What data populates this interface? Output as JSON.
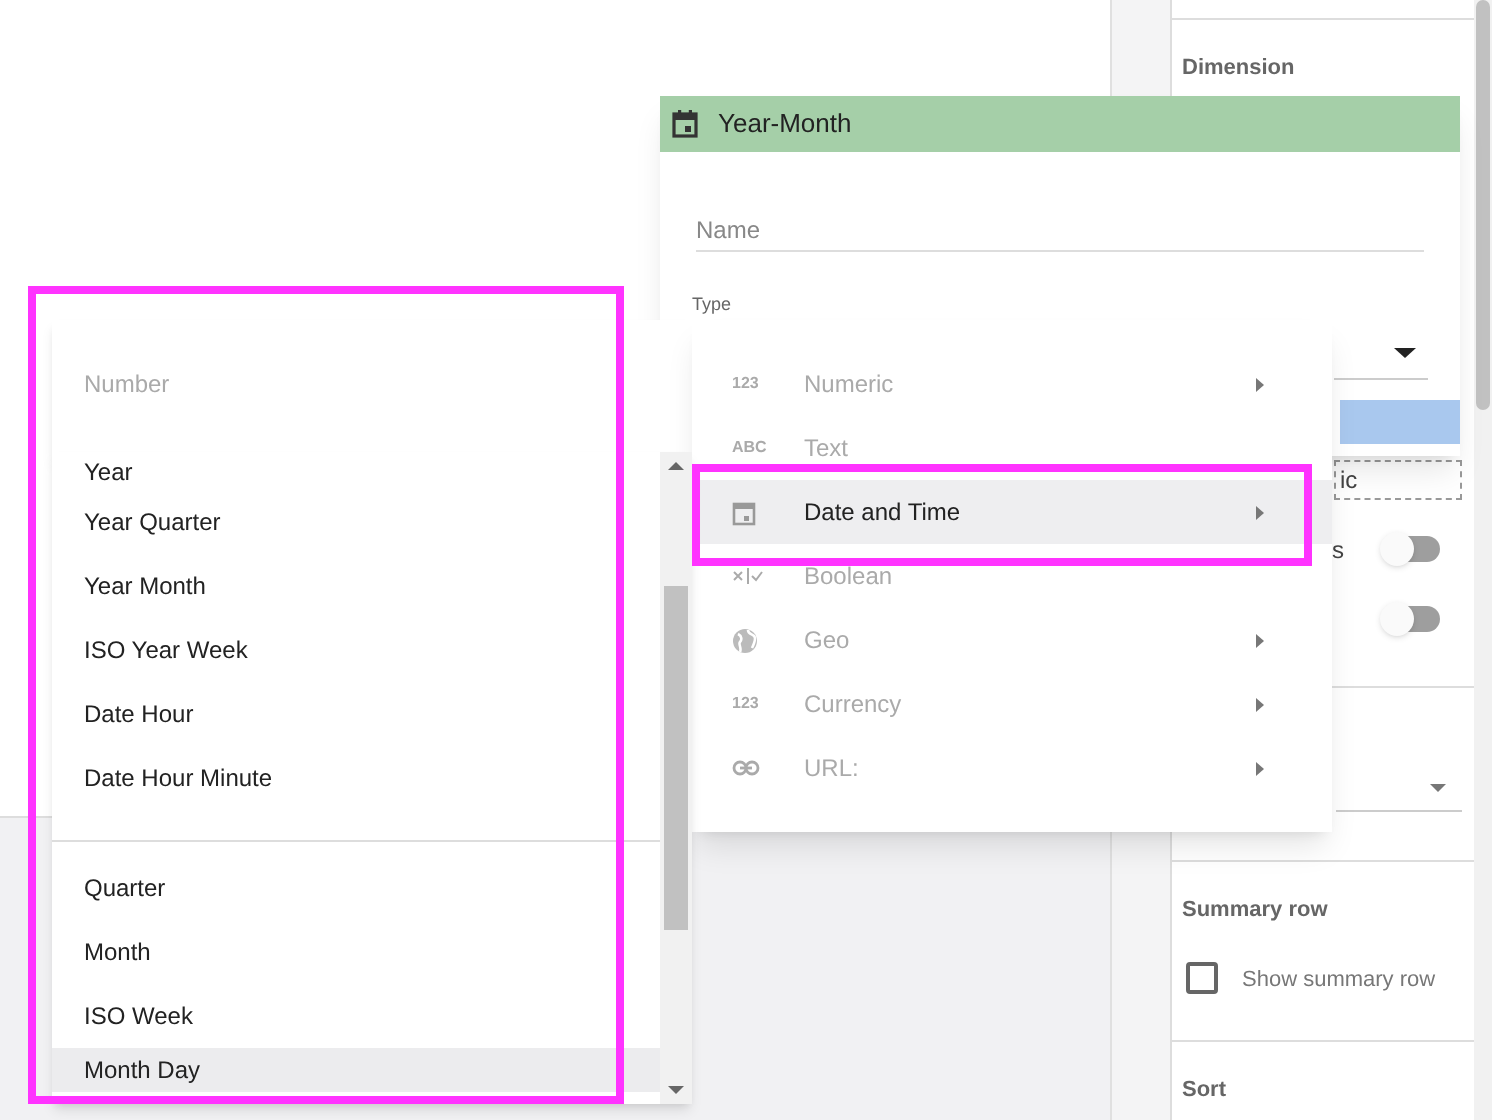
{
  "dialog": {
    "title": "Year-Month",
    "name_placeholder": "Name",
    "type_label": "Type"
  },
  "number_menu": {
    "items": [
      "Number"
    ]
  },
  "type_menu": {
    "items": [
      {
        "label": "Numeric",
        "glyph": "123",
        "disabled": true,
        "selected": false,
        "submenu": true
      },
      {
        "label": "Text",
        "glyph": "ABC",
        "disabled": true,
        "selected": false,
        "submenu": false
      },
      {
        "label": "Date and Time",
        "disabled": false,
        "selected": true,
        "submenu": true
      },
      {
        "label": "Boolean",
        "disabled": true,
        "selected": false,
        "submenu": false
      },
      {
        "label": "Geo",
        "disabled": true,
        "selected": false,
        "submenu": true
      },
      {
        "label": "Currency",
        "glyph": "123",
        "disabled": true,
        "selected": false,
        "submenu": true
      },
      {
        "label": "URL:",
        "disabled": true,
        "selected": false,
        "submenu": true
      }
    ]
  },
  "date_list": {
    "groups": [
      [
        {
          "label": "Year",
          "selected": false
        },
        {
          "label": "Year Quarter",
          "selected": false
        },
        {
          "label": "Year Month",
          "selected": false
        },
        {
          "label": "ISO Year Week",
          "selected": false
        },
        {
          "label": "Date Hour",
          "selected": false
        },
        {
          "label": "Date Hour Minute",
          "selected": false
        }
      ],
      [
        {
          "label": "Quarter",
          "selected": false
        },
        {
          "label": "Month",
          "selected": false
        },
        {
          "label": "ISO Week",
          "selected": false
        },
        {
          "label": "Month Day",
          "selected": true
        }
      ]
    ]
  },
  "side_panel": {
    "dimension_title": "Dimension",
    "chip_text": "ic",
    "toggle_rows": [
      {
        "label": "s",
        "on": false
      },
      {
        "on": false
      }
    ],
    "summary_title": "Summary row",
    "summary_checkbox": {
      "label": "Show summary row",
      "checked": false
    },
    "sort_title": "Sort"
  },
  "annotations": [
    {
      "kind": "frame"
    },
    {
      "kind": "frame"
    }
  ]
}
